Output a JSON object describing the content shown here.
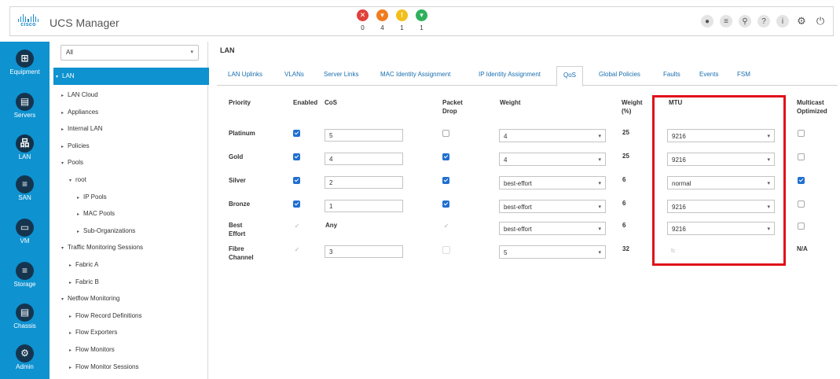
{
  "header": {
    "logo_text": "cisco",
    "title": "UCS Manager",
    "faults": [
      {
        "name": "critical",
        "symbol": "✕",
        "color": "#e0413a",
        "count": "0"
      },
      {
        "name": "major",
        "symbol": "▾",
        "color": "#f07c1e",
        "count": "4"
      },
      {
        "name": "minor",
        "symbol": "!",
        "color": "#f2be1a",
        "count": "1"
      },
      {
        "name": "warning",
        "symbol": "▾",
        "color": "#2fb05b",
        "count": "1"
      }
    ],
    "icons": [
      {
        "name": "status-icon",
        "glyph": "●"
      },
      {
        "name": "list-icon",
        "glyph": "≡"
      },
      {
        "name": "search-icon",
        "glyph": "⚲"
      },
      {
        "name": "help-icon",
        "glyph": "?"
      },
      {
        "name": "info-icon",
        "glyph": "i"
      },
      {
        "name": "gear-icon",
        "glyph": "⚙"
      },
      {
        "name": "logout-icon",
        "glyph": "⏻"
      }
    ]
  },
  "rail": [
    {
      "label": "Equipment",
      "glyph": "⊞"
    },
    {
      "label": "Servers",
      "glyph": "▤"
    },
    {
      "label": "LAN",
      "glyph": "品"
    },
    {
      "label": "SAN",
      "glyph": "≡"
    },
    {
      "label": "VM",
      "glyph": "▭"
    },
    {
      "label": "Storage",
      "glyph": "≡"
    },
    {
      "label": "Chassis",
      "glyph": "▤"
    },
    {
      "label": "Admin",
      "glyph": "⚙"
    }
  ],
  "tree": {
    "filter_value": "All",
    "selected": "LAN",
    "items": [
      {
        "label": "LAN Cloud",
        "tri": "▸"
      },
      {
        "label": "Appliances",
        "tri": "▸"
      },
      {
        "label": "Internal LAN",
        "tri": "▸"
      },
      {
        "label": "Policies",
        "tri": "▸"
      },
      {
        "label": "Pools",
        "tri": "▾"
      },
      {
        "label": "root",
        "tri": "▾"
      },
      {
        "label": "IP Pools",
        "tri": "▸"
      },
      {
        "label": "MAC Pools",
        "tri": "▸"
      },
      {
        "label": "Sub-Organizations",
        "tri": "▸"
      },
      {
        "label": "Traffic Monitoring Sessions",
        "tri": "▾"
      },
      {
        "label": "Fabric A",
        "tri": "▸"
      },
      {
        "label": "Fabric B",
        "tri": "▸"
      },
      {
        "label": "Netflow Monitoring",
        "tri": "▾"
      },
      {
        "label": "Flow Record Definitions",
        "tri": "▸"
      },
      {
        "label": "Flow Exporters",
        "tri": "▸"
      },
      {
        "label": "Flow Monitors",
        "tri": "▸"
      },
      {
        "label": "Flow Monitor Sessions",
        "tri": "▸"
      }
    ]
  },
  "main": {
    "breadcrumb": "LAN",
    "tabs": [
      "LAN Uplinks",
      "VLANs",
      "Server Links",
      "MAC Identity Assignment",
      "IP Identity Assignment",
      "QoS",
      "Global Policies",
      "Faults",
      "Events",
      "FSM"
    ],
    "active_tab": "QoS",
    "columns": {
      "priority": "Priority",
      "enabled": "Enabled",
      "cos": "CoS",
      "packet_drop": [
        "Packet",
        "Drop"
      ],
      "weight": "Weight",
      "weight_pct": [
        "Weight",
        "(%)"
      ],
      "mtu": "MTU",
      "multicast": [
        "Multicast",
        "Optimized"
      ]
    },
    "rows": [
      {
        "priority": [
          "Platinum"
        ],
        "enabled": "on",
        "cos": "5",
        "packet_drop": "off",
        "weight": "4",
        "weight_pct": "25",
        "mtu": "9216",
        "multicast": "off"
      },
      {
        "priority": [
          "Gold"
        ],
        "enabled": "on",
        "cos": "4",
        "packet_drop": "on",
        "weight": "4",
        "weight_pct": "25",
        "mtu": "9216",
        "multicast": "off"
      },
      {
        "priority": [
          "Silver"
        ],
        "enabled": "on",
        "cos": "2",
        "packet_drop": "on",
        "weight": "best-effort",
        "weight_pct": "6",
        "mtu": "normal",
        "multicast": "on"
      },
      {
        "priority": [
          "Bronze"
        ],
        "enabled": "on",
        "cos": "1",
        "packet_drop": "on",
        "weight": "best-effort",
        "weight_pct": "6",
        "mtu": "9216",
        "multicast": "off"
      },
      {
        "priority": [
          "Best",
          "Effort"
        ],
        "enabled": "dis-check",
        "cos": "Any",
        "packet_drop": "dis-check",
        "weight": "best-effort",
        "weight_pct": "6",
        "mtu": "9216",
        "multicast": "off"
      },
      {
        "priority": [
          "Fibre",
          "Channel"
        ],
        "enabled": "dis-check",
        "cos": "3",
        "packet_drop": "dis-box",
        "weight": "5",
        "weight_pct": "32",
        "mtu": "fc",
        "multicast": "N/A"
      }
    ],
    "highlight_color": "#e0101a"
  }
}
